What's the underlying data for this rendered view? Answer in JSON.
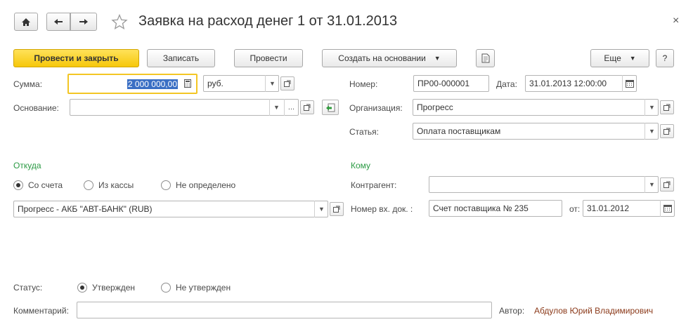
{
  "header": {
    "title": "Заявка на расход денег 1 от 31.01.2013",
    "close_glyph": "×"
  },
  "toolbar": {
    "post_close": "Провести и закрыть",
    "save": "Записать",
    "post": "Провести",
    "create_based": "Создать на основании",
    "more": "Еще",
    "help": "?"
  },
  "form": {
    "amount_label": "Сумма:",
    "amount_value": "2 000 000,00",
    "currency_value": "руб.",
    "basis_label": "Основание:",
    "basis_value": "",
    "number_label": "Номер:",
    "number_value": "ПР00-000001",
    "date_label": "Дата:",
    "date_value": "31.01.2013 12:00:00",
    "org_label": "Организация:",
    "org_value": "Прогресс",
    "article_label": "Статья:",
    "article_value": "Оплата поставщикам"
  },
  "from": {
    "title": "Откуда",
    "options": [
      "Со счета",
      "Из кассы",
      "Не определено"
    ],
    "selected": 0,
    "account_value": "Прогресс - АКБ \"АВТ-БАНК\" (RUB)"
  },
  "to": {
    "title": "Кому",
    "counterparty_label": "Контрагент:",
    "counterparty_value": "",
    "incoming_doc_label": "Номер вх. док. :",
    "incoming_doc_value": "Счет поставщика № 235",
    "from_label": "от:",
    "from_date_value": "31.01.2012"
  },
  "status": {
    "label": "Статус:",
    "options": [
      "Утвержден",
      "Не утвержден"
    ],
    "selected": 0
  },
  "comment": {
    "label": "Комментарий:",
    "value": ""
  },
  "author": {
    "label": "Автор:",
    "value": "Абдулов Юрий Владимирович"
  },
  "colors": {
    "primary_button": "#f6c70a",
    "section_title": "#2a9a43",
    "author_link": "#8b3a1a",
    "focus_border": "#f3c624",
    "selection": "#3a6fc4"
  }
}
